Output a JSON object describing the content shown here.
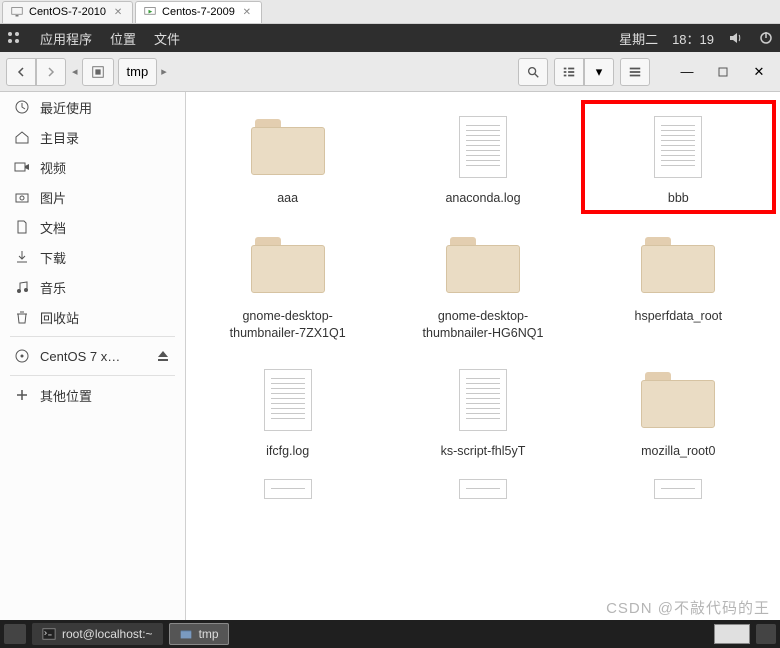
{
  "vm_tabs": [
    {
      "label": "CentOS-7-2010",
      "active": false
    },
    {
      "label": "Centos-7-2009",
      "active": true
    }
  ],
  "menubar": {
    "apps": "应用程序",
    "places": "位置",
    "files": "文件",
    "day": "星期二",
    "time": "18：19"
  },
  "toolbar": {
    "breadcrumb_current": "tmp"
  },
  "sidebar": {
    "recent": "最近使用",
    "home": "主目录",
    "videos": "视频",
    "pictures": "图片",
    "documents": "文档",
    "downloads": "下载",
    "music": "音乐",
    "trash": "回收站",
    "disk": "CentOS 7 x…",
    "other": "其他位置"
  },
  "files": [
    {
      "name": "aaa",
      "type": "folder",
      "highlight": false
    },
    {
      "name": "anaconda.log",
      "type": "doc",
      "highlight": false
    },
    {
      "name": "bbb",
      "type": "doc",
      "highlight": true
    },
    {
      "name": "gnome-desktop-thumbnailer-7ZX1Q1",
      "type": "folder",
      "highlight": false
    },
    {
      "name": "gnome-desktop-thumbnailer-HG6NQ1",
      "type": "folder",
      "highlight": false
    },
    {
      "name": "hsperfdata_root",
      "type": "folder",
      "highlight": false
    },
    {
      "name": "ifcfg.log",
      "type": "doc",
      "highlight": false
    },
    {
      "name": "ks-script-fhl5yT",
      "type": "doc",
      "highlight": false
    },
    {
      "name": "mozilla_root0",
      "type": "folder",
      "highlight": false
    }
  ],
  "taskbar": {
    "terminal": "root@localhost:~",
    "filemanager": "tmp"
  },
  "watermark": "CSDN @不敲代码的王"
}
